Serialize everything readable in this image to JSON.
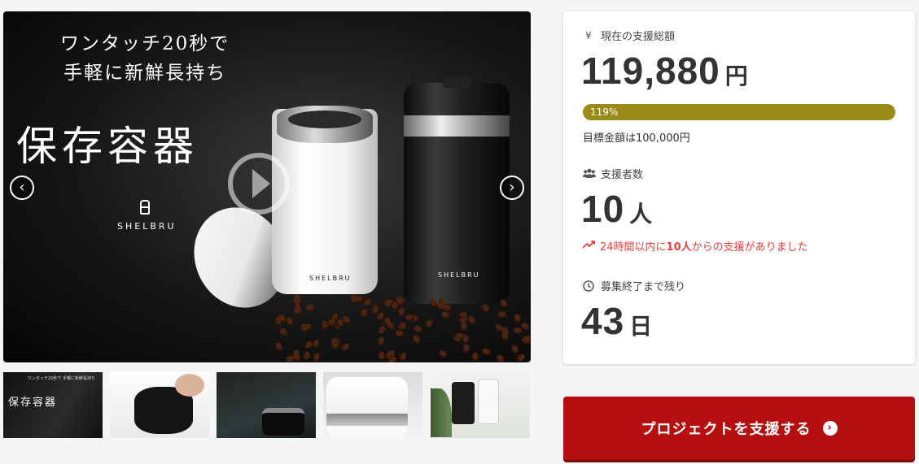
{
  "gallery": {
    "hero": {
      "subtitle_line1": "ワンタッチ20秒で",
      "subtitle_line2": "手軽に新鮮長持ち",
      "title": "保存容器",
      "brand": "SHELBRU",
      "can_label": "SHELBRU"
    },
    "prev_icon": "chevron-left-icon",
    "next_icon": "chevron-right-icon",
    "play_icon": "play-icon",
    "thumbnails": [
      {
        "title": "保存容器",
        "subtitle": "ワンタッチ20秒で 手軽に新鮮長持ち"
      },
      {},
      {},
      {},
      {}
    ]
  },
  "stats": {
    "funding": {
      "label": "現在の支援総額",
      "icon": "yen-icon",
      "amount": "119,880",
      "unit": "円"
    },
    "progress": {
      "percent_label": "119%",
      "fraction": 1.0,
      "color": "#9a8a17"
    },
    "goal": "目標金額は100,000円",
    "backers": {
      "label": "支援者数",
      "icon": "users-icon",
      "count": "10",
      "unit": "人"
    },
    "trend": {
      "icon": "trending-up-icon",
      "prefix": "24時間以内に",
      "count": "10人",
      "suffix": "からの支援がありました",
      "color": "#e53e3e"
    },
    "remaining": {
      "label": "募集終了まで残り",
      "icon": "clock-icon",
      "count": "43",
      "unit": "日"
    }
  },
  "cta": {
    "label": "プロジェクトを支援する",
    "icon": "arrow-right-circle-icon",
    "color": "#b5100f"
  }
}
